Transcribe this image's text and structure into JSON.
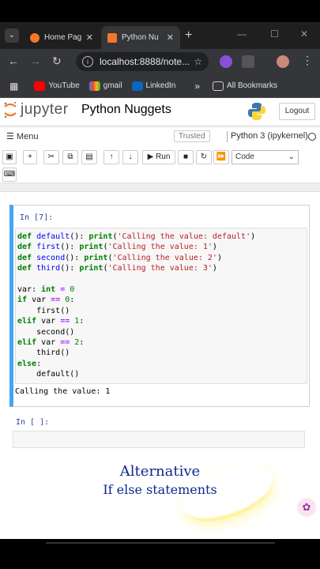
{
  "browser": {
    "tabs": [
      {
        "title": "Home Pag",
        "active": false
      },
      {
        "title": "Python Nu",
        "active": true
      }
    ],
    "address": "localhost:8888/note...",
    "bookmarks": [
      "YouTube",
      "gmail",
      "LinkedIn"
    ],
    "more_label": "»",
    "all_bookmarks": "All Bookmarks"
  },
  "jupyter": {
    "brand": "jupyter",
    "notebook_title": "Python Nuggets",
    "logout_label": "Logout",
    "menu_label": "Menu",
    "trusted_label": "Trusted",
    "kernel_label": "Python 3 (ipykernel)",
    "run_label": "Run",
    "cell_type": "Code"
  },
  "cells": [
    {
      "prompt": "In [7]:",
      "output": "Calling the value: 1"
    },
    {
      "prompt": "In [ ]:"
    }
  ],
  "code_lines": [
    "def default(): print('Calling the value: default')",
    "def first(): print('Calling the value: 1')",
    "def second(): print('Calling the value: 2')",
    "def third(): print('Calling the value: 3')",
    "",
    "var: int = 0",
    "if var == 0:",
    "    first()",
    "elif var == 1:",
    "    second()",
    "elif var == 2:",
    "    third()",
    "else:",
    "    default()"
  ],
  "caption": {
    "line1": "Alternative",
    "line2": "If else statements"
  },
  "colors": {
    "accent": "#42a5f5",
    "caption": "#0d2a8a"
  }
}
